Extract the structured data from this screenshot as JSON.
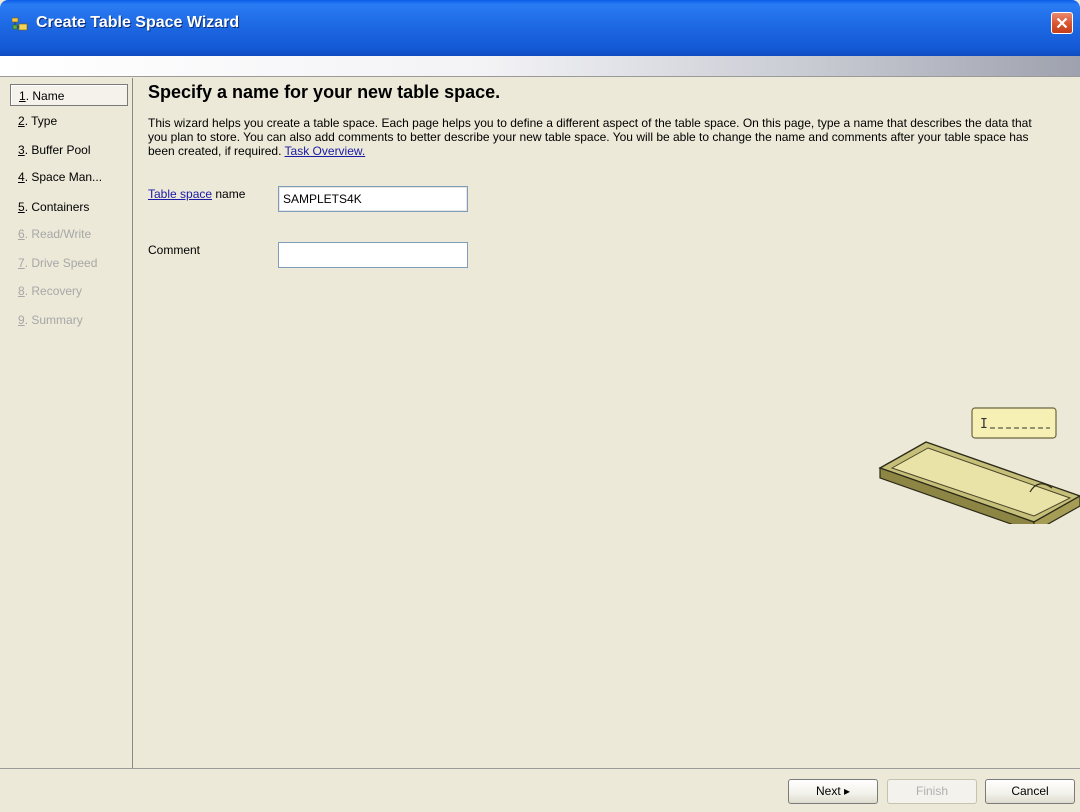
{
  "window": {
    "title": "Create Table Space Wizard"
  },
  "steps": [
    {
      "number": "1",
      "label": ". Name",
      "state": "active"
    },
    {
      "number": "2",
      "label": ". Type",
      "state": "enabled"
    },
    {
      "number": "3",
      "label": ". Buffer Pool",
      "state": "enabled"
    },
    {
      "number": "4",
      "label": ". Space Man...",
      "state": "enabled"
    },
    {
      "number": "5",
      "label": ". Containers",
      "state": "enabled"
    },
    {
      "number": "6",
      "label": ". Read/Write",
      "state": "disabled"
    },
    {
      "number": "7",
      "label": ". Drive Speed",
      "state": "disabled"
    },
    {
      "number": "8",
      "label": ". Recovery",
      "state": "disabled"
    },
    {
      "number": "9",
      "label": ". Summary",
      "state": "disabled"
    }
  ],
  "page": {
    "heading": "Specify a name for your new table space.",
    "description": "This wizard helps you create a table space.  Each page helps you to define a different aspect of the table space.  On this page, type a name that describes the data that you plan to store.  You can also add comments to better describe your new table space.  You will be able to change the name and comments after your table space has been created, if required.",
    "task_link": "Task Overview.",
    "name_label_link": "Table space",
    "name_label_text": " name",
    "name_value": "SAMPLETS4K",
    "comment_label": "Comment",
    "comment_value": ""
  },
  "buttons": {
    "next": "Next ▸",
    "finish": "Finish",
    "cancel": "Cancel"
  },
  "colors": {
    "titlebar": "#1f6be6",
    "link": "#1a1aa6",
    "disabled_text": "#a7a7a7"
  },
  "icons": [
    "app-icon",
    "close-icon",
    "table-space-illustration"
  ]
}
